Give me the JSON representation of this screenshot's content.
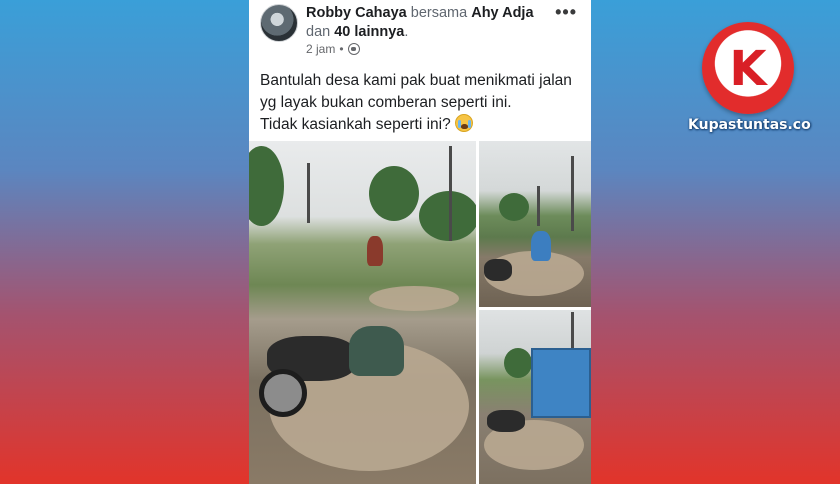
{
  "post": {
    "author": "Robby Cahaya",
    "with_word": "bersama",
    "tagged": "Ahy Adja",
    "and_word": "dan",
    "others": "40 lainnya",
    "period": ".",
    "time": "2 jam",
    "separator": "•",
    "privacy_icon": "globe-icon",
    "more_label": "•••",
    "text_lines": [
      "Bantulah desa kami pak buat menikmati jalan",
      "yg layak bukan comberan seperti ini.",
      "Tidak kasiankah seperti ini?"
    ],
    "emoji": "crying-face-icon"
  },
  "photos": [
    {
      "id": "main",
      "subject": "motorcycle-fall-in-puddle"
    },
    {
      "id": "top-right",
      "subject": "motorcycle-splash"
    },
    {
      "id": "bottom-right",
      "subject": "truck-and-fallen-motorcycle"
    }
  ],
  "watermark": {
    "logo_letter": "K",
    "site": "Kupastuntas.co",
    "colors": {
      "red": "#d91f26",
      "ring": "#e22c2c"
    }
  },
  "background_colors": {
    "top": "#3a9fd8",
    "bottom": "#e2342a"
  }
}
